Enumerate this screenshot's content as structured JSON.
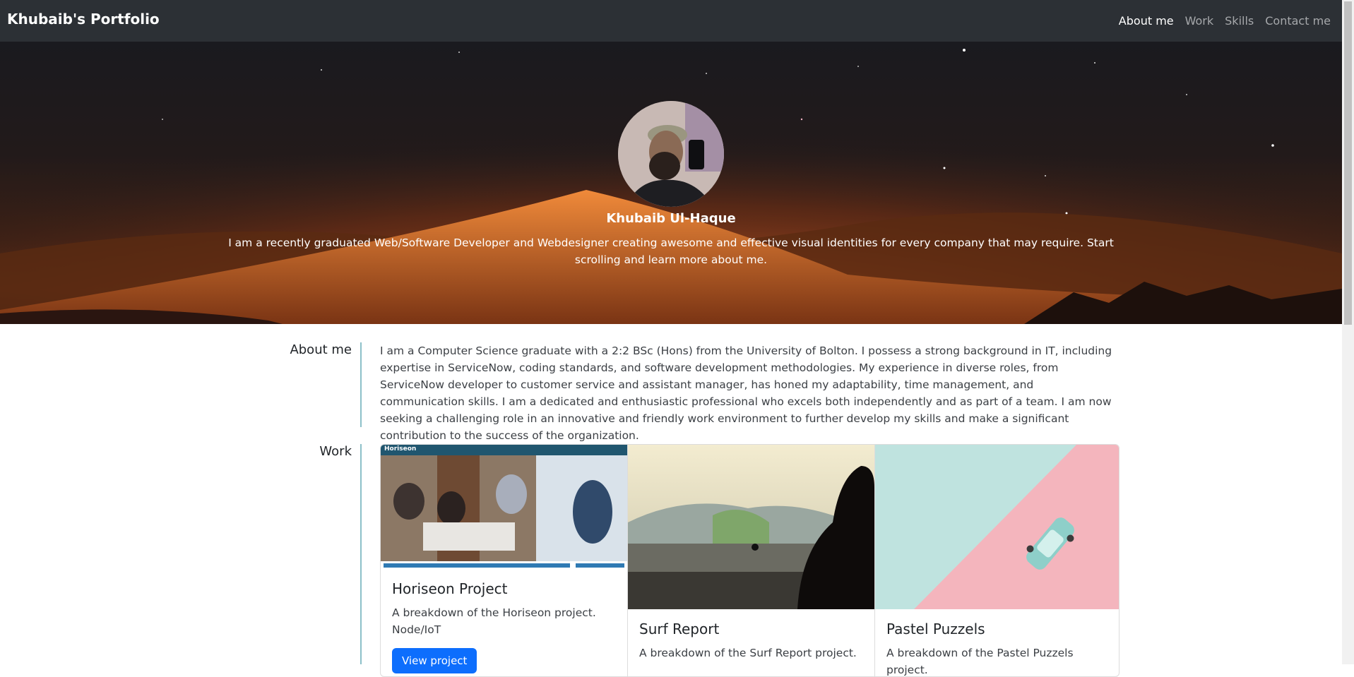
{
  "navbar": {
    "brand": "Khubaib's Portfolio",
    "links": [
      "About me",
      "Work",
      "Skills",
      "Contact me"
    ],
    "active": "About me"
  },
  "hero": {
    "name": "Khubaib Ul-Haque",
    "description": "I am a recently graduated Web/Software Developer and Webdesigner creating awesome and effective visual identities for every company that may require. Start scrolling and learn more about me."
  },
  "about": {
    "label": "About me",
    "text": "I am a Computer Science graduate with a 2:2 BSc (Hons) from the University of Bolton. I possess a strong background in IT, including expertise in ServiceNow, coding standards, and software development methodologies. My experience in diverse roles, from ServiceNow developer to customer service and assistant manager, has honed my adaptability, time management, and communication skills. I am a dedicated and enthusiastic professional who excels both independently and as part of a team. I am now seeking a challenging role in an innovative and friendly work environment to further develop my skills and make a significant contribution to the success of the organization."
  },
  "work": {
    "label": "Work",
    "cards": [
      {
        "title": "Horiseon Project",
        "text": "A breakdown of the Horiseon project.",
        "subtext": "Node/IoT",
        "button": "View project",
        "image_caption": "Horiseon"
      },
      {
        "title": "Surf Report",
        "text": "A breakdown of the Surf Report project.",
        "subtext": "",
        "button": ""
      },
      {
        "title": "Pastel Puzzels",
        "text": "A breakdown of the Pastel Puzzels project.",
        "subtext": "",
        "button": ""
      }
    ]
  },
  "colors": {
    "navbar_bg": "#2c3035",
    "accent_divider": "#8dc0c9",
    "button": "#0d6efd"
  }
}
